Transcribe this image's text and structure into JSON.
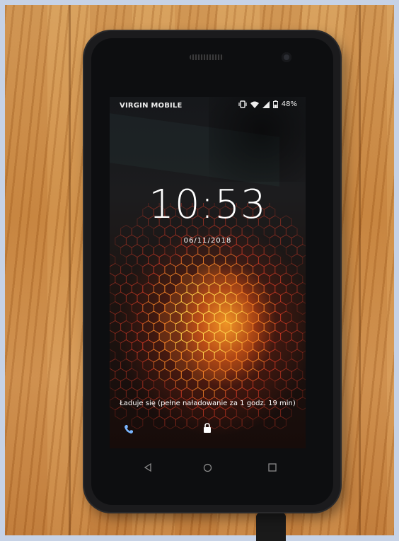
{
  "status_bar": {
    "carrier": "VIRGIN MOBILE",
    "battery_percent": "48%",
    "icons": [
      "vibrate-icon",
      "wifi-icon",
      "signal-icon",
      "battery-icon"
    ]
  },
  "lockscreen": {
    "time": "10:53",
    "date": "06/11/2018",
    "charging_status": "Ładuje się (pełne naładowanie za 1 godz. 19 min)"
  },
  "shortcuts": {
    "left": "phone-icon",
    "center": "lock-icon"
  },
  "nav_bar": [
    "back-icon",
    "home-icon",
    "recents-icon"
  ],
  "colors": {
    "wood": "#c9863f",
    "hex_glow": "#ff7a2a",
    "phone_body": "#1b1b1d"
  }
}
